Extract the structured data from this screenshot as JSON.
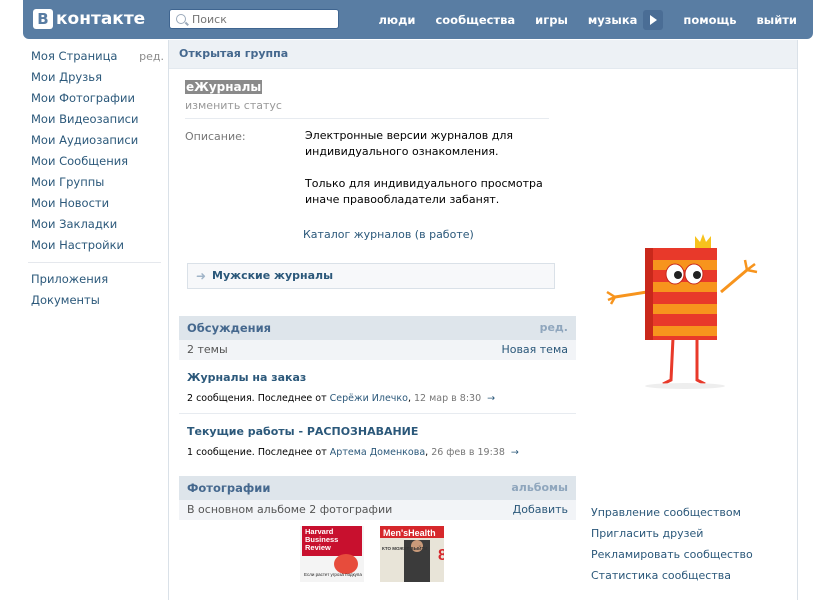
{
  "header": {
    "logo_letter": "В",
    "logo_text": "контакте",
    "search_placeholder": "Поиск",
    "nav": [
      "люди",
      "сообщества",
      "игры",
      "музыка",
      "помощь",
      "выйти"
    ]
  },
  "left_menu": {
    "items": [
      {
        "label": "Моя Страница",
        "edit": "ред."
      },
      {
        "label": "Мои Друзья"
      },
      {
        "label": "Мои Фотографии"
      },
      {
        "label": "Мои Видеозаписи"
      },
      {
        "label": "Мои Аудиозаписи"
      },
      {
        "label": "Мои Сообщения"
      },
      {
        "label": "Мои Группы"
      },
      {
        "label": "Мои Новости"
      },
      {
        "label": "Мои Закладки"
      },
      {
        "label": "Мои Настройки"
      }
    ],
    "extra": [
      "Приложения",
      "Документы"
    ]
  },
  "group": {
    "type_label": "Открытая группа",
    "name": "еЖурналы",
    "status_link": "изменить статус",
    "description_label": "Описание:",
    "description_1": "Электронные версии журналов для индивидуального ознакомления.",
    "description_2": "Только для индивидуального просмотра иначе правообладатели забанят.",
    "catalog_link": "Каталог журналов (в работе)",
    "wiki_link": "Мужские журналы"
  },
  "discussions": {
    "title": "Обсуждения",
    "edit": "ред.",
    "count": "2 темы",
    "new_topic": "Новая тема",
    "topics": [
      {
        "title": "Журналы на заказ",
        "meta": "2 сообщения. Последнее от",
        "author": "Серёжи Илечко",
        "date": "12 мар в 8:30",
        "arrow": "→"
      },
      {
        "title": "Текущие работы - РАСПОЗНАВАНИЕ",
        "meta": "1 сообщение. Последнее от",
        "author": "Артема Доменкова",
        "date": "26 фев в 19:38",
        "arrow": "→"
      }
    ]
  },
  "photos": {
    "title": "Фотографии",
    "albums_link": "альбомы",
    "caption": "В основном альбоме 2 фотографии",
    "add": "Добавить",
    "covers": [
      {
        "line1": "Harvard",
        "line2": "Business",
        "line3": "Review",
        "tag": "Если растет угроза подкупа"
      },
      {
        "brand": "Men'sHealth",
        "num": "8",
        "tag": "КТО МОЖЕТ ВЫЙТИ"
      }
    ]
  },
  "right_links": [
    "Управление сообществом",
    "Пригласить друзей",
    "Рекламировать сообщество",
    "Статистика сообщества"
  ],
  "colors": {
    "header": "#597da3",
    "link": "#2b587a",
    "section_bg": "#dee5eb",
    "mascot_orange": "#f7941d",
    "mascot_red": "#e8392a"
  }
}
